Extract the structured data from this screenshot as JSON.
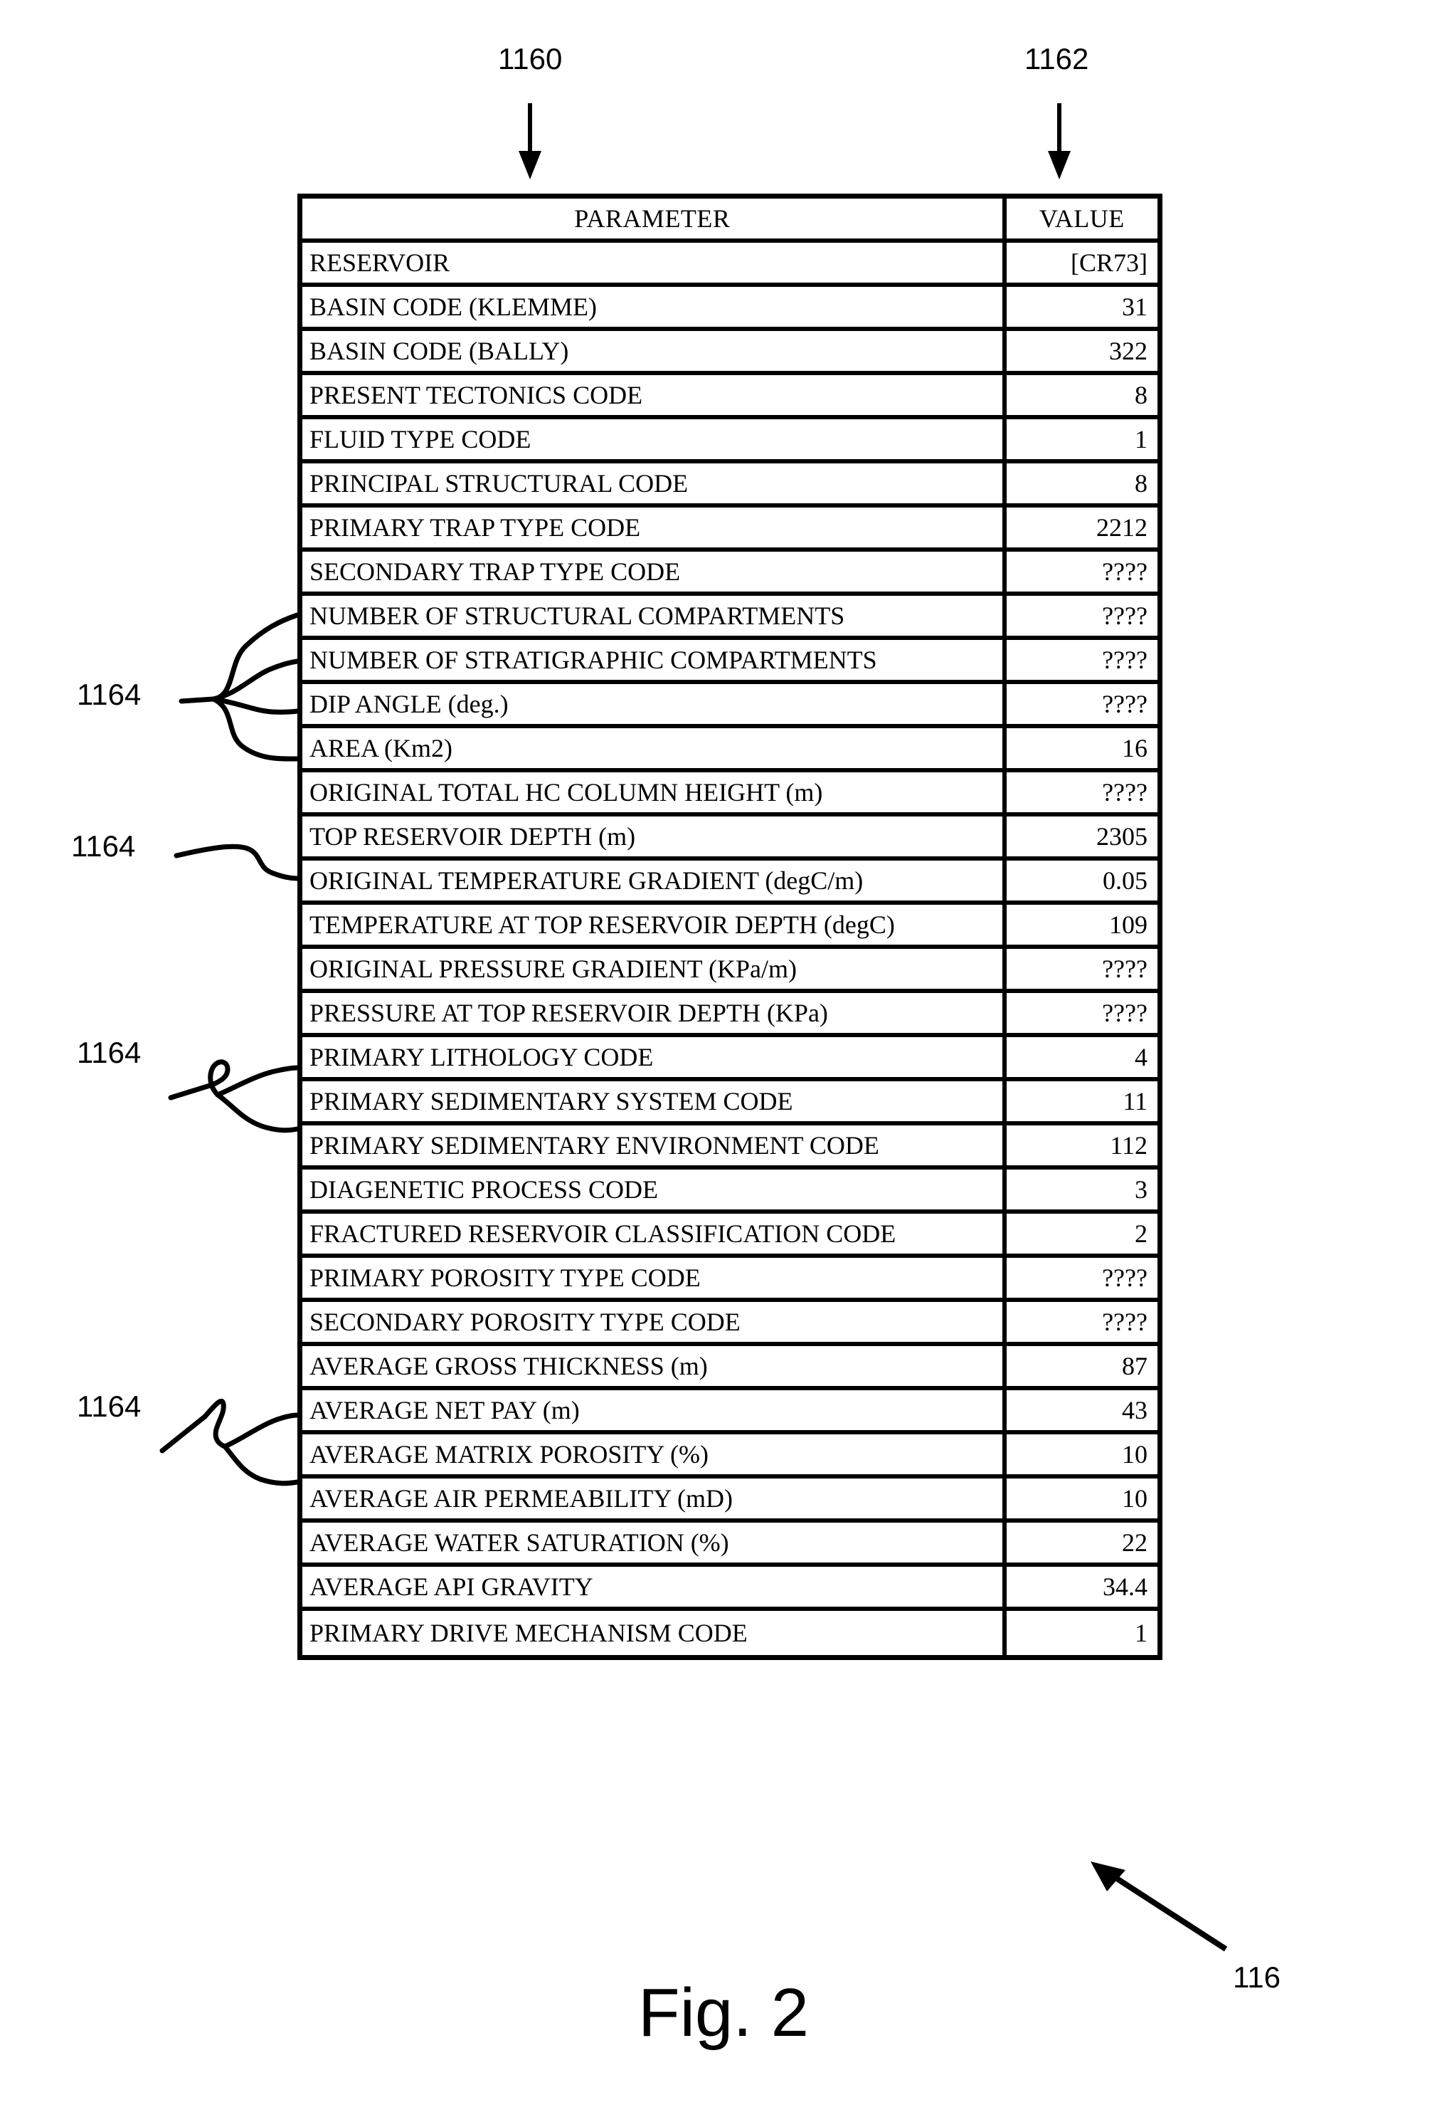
{
  "figure": {
    "caption": "Fig. 2"
  },
  "callouts": {
    "parameter_column_ref": "1160",
    "value_column_ref": "1162",
    "table_ref": "116",
    "missing_value_refs": [
      "1164",
      "1164",
      "1164",
      "1164"
    ]
  },
  "table": {
    "headers": {
      "parameter": "PARAMETER",
      "value": "VALUE"
    },
    "rows": [
      {
        "parameter": "RESERVOIR",
        "value": "[CR73]"
      },
      {
        "parameter": "BASIN CODE (KLEMME)",
        "value": "31"
      },
      {
        "parameter": "BASIN CODE (BALLY)",
        "value": "322"
      },
      {
        "parameter": "PRESENT TECTONICS CODE",
        "value": "8"
      },
      {
        "parameter": "FLUID TYPE CODE",
        "value": "1"
      },
      {
        "parameter": "PRINCIPAL STRUCTURAL CODE",
        "value": "8"
      },
      {
        "parameter": "PRIMARY TRAP TYPE CODE",
        "value": "2212"
      },
      {
        "parameter": "SECONDARY TRAP TYPE CODE",
        "value": "????"
      },
      {
        "parameter": "NUMBER OF STRUCTURAL COMPARTMENTS",
        "value": "????"
      },
      {
        "parameter": "NUMBER OF STRATIGRAPHIC COMPARTMENTS",
        "value": "????"
      },
      {
        "parameter": "DIP ANGLE (deg.)",
        "value": "????"
      },
      {
        "parameter": "AREA (Km2)",
        "value": "16"
      },
      {
        "parameter": "ORIGINAL TOTAL HC COLUMN HEIGHT (m)",
        "value": "????"
      },
      {
        "parameter": "TOP RESERVOIR DEPTH (m)",
        "value": "2305"
      },
      {
        "parameter": "ORIGINAL TEMPERATURE GRADIENT (degC/m)",
        "value": "0.05"
      },
      {
        "parameter": "TEMPERATURE AT TOP RESERVOIR DEPTH (degC)",
        "value": "109"
      },
      {
        "parameter": "ORIGINAL PRESSURE GRADIENT (KPa/m)",
        "value": "????"
      },
      {
        "parameter": "PRESSURE AT TOP RESERVOIR DEPTH (KPa)",
        "value": "????"
      },
      {
        "parameter": "PRIMARY LITHOLOGY CODE",
        "value": "4"
      },
      {
        "parameter": "PRIMARY SEDIMENTARY SYSTEM CODE",
        "value": "11"
      },
      {
        "parameter": "PRIMARY SEDIMENTARY ENVIRONMENT CODE",
        "value": "112"
      },
      {
        "parameter": "DIAGENETIC PROCESS CODE",
        "value": "3"
      },
      {
        "parameter": "FRACTURED RESERVOIR CLASSIFICATION CODE",
        "value": "2"
      },
      {
        "parameter": "PRIMARY POROSITY TYPE CODE",
        "value": "????"
      },
      {
        "parameter": "SECONDARY POROSITY TYPE CODE",
        "value": "????"
      },
      {
        "parameter": "AVERAGE GROSS THICKNESS (m)",
        "value": "87"
      },
      {
        "parameter": "AVERAGE NET PAY (m)",
        "value": "43"
      },
      {
        "parameter": "AVERAGE MATRIX POROSITY (%)",
        "value": "10"
      },
      {
        "parameter": "AVERAGE AIR PERMEABILITY (mD)",
        "value": "10"
      },
      {
        "parameter": "AVERAGE WATER SATURATION (%)",
        "value": "22"
      },
      {
        "parameter": "AVERAGE API GRAVITY",
        "value": "34.4"
      },
      {
        "parameter": "PRIMARY DRIVE MECHANISM CODE",
        "value": "1"
      }
    ]
  }
}
